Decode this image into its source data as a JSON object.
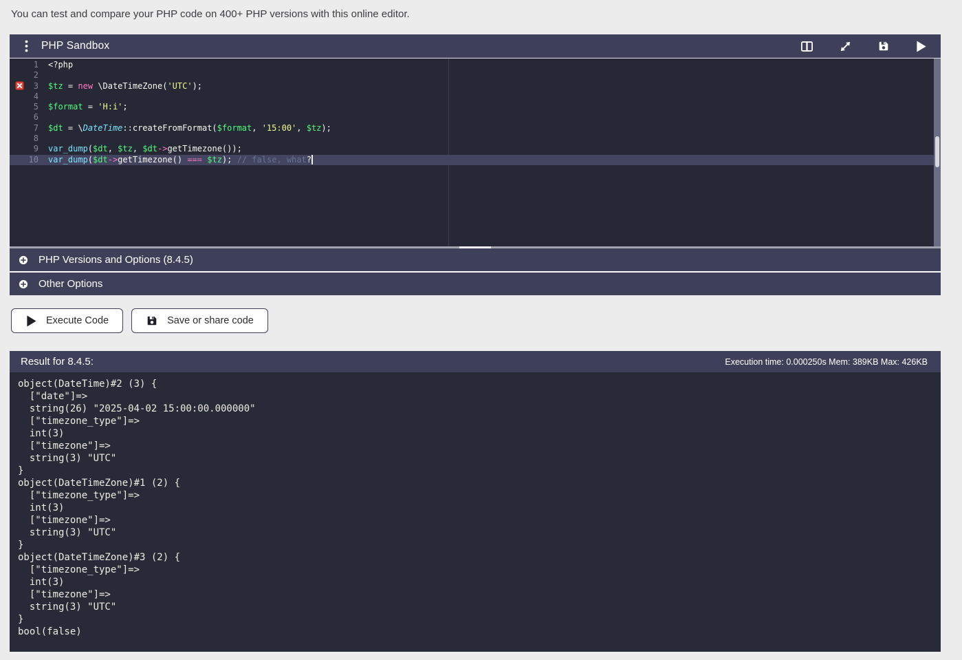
{
  "page": {
    "intro": "You can test and compare your PHP code on 400+ PHP versions with this online editor."
  },
  "colors": {
    "panel_bar": "#3e4059",
    "editor_bg": "#262836",
    "result_bg": "#282a38",
    "active_line": "#434560",
    "error_marker": "#d8453e",
    "token_variable": "#50fa7b",
    "token_keyword": "#ff79c6",
    "token_string": "#f1fa8c",
    "token_builtin": "#7be3fd",
    "token_comment": "#6a7193",
    "page_bg": "#ececec"
  },
  "editor": {
    "title": "PHP Sandbox",
    "menu_icon": "kebab-menu",
    "header_icons": [
      {
        "name": "split-view"
      },
      {
        "name": "fullscreen"
      },
      {
        "name": "save"
      },
      {
        "name": "run"
      }
    ],
    "active_line": 10,
    "error_line": 3,
    "lines": [
      {
        "n": "1",
        "tokens": [
          {
            "t": "<?php",
            "c": "p"
          }
        ]
      },
      {
        "n": "2",
        "tokens": []
      },
      {
        "n": "3",
        "error": true,
        "tokens": [
          {
            "t": "$tz",
            "c": "v"
          },
          {
            "t": " = ",
            "c": "p"
          },
          {
            "t": "new",
            "c": "k"
          },
          {
            "t": " \\DateTimeZone(",
            "c": "p"
          },
          {
            "t": "'UTC'",
            "c": "s"
          },
          {
            "t": ");",
            "c": "p"
          }
        ]
      },
      {
        "n": "4",
        "tokens": []
      },
      {
        "n": "5",
        "tokens": [
          {
            "t": "$format",
            "c": "v"
          },
          {
            "t": " = ",
            "c": "p"
          },
          {
            "t": "'H:i'",
            "c": "s"
          },
          {
            "t": ";",
            "c": "p"
          }
        ]
      },
      {
        "n": "6",
        "tokens": []
      },
      {
        "n": "7",
        "tokens": [
          {
            "t": "$dt",
            "c": "v"
          },
          {
            "t": " = \\",
            "c": "p"
          },
          {
            "t": "DateTime",
            "c": "ci"
          },
          {
            "t": "::createFromFormat(",
            "c": "p"
          },
          {
            "t": "$format",
            "c": "v"
          },
          {
            "t": ", ",
            "c": "p"
          },
          {
            "t": "'15:00'",
            "c": "s"
          },
          {
            "t": ", ",
            "c": "p"
          },
          {
            "t": "$tz",
            "c": "v"
          },
          {
            "t": ");",
            "c": "p"
          }
        ]
      },
      {
        "n": "8",
        "tokens": []
      },
      {
        "n": "9",
        "tokens": [
          {
            "t": "var_dump",
            "c": "f"
          },
          {
            "t": "(",
            "c": "p"
          },
          {
            "t": "$dt",
            "c": "v"
          },
          {
            "t": ", ",
            "c": "p"
          },
          {
            "t": "$tz",
            "c": "v"
          },
          {
            "t": ", ",
            "c": "p"
          },
          {
            "t": "$dt",
            "c": "v"
          },
          {
            "t": "->",
            "c": "o"
          },
          {
            "t": "getTimezone());",
            "c": "p"
          }
        ]
      },
      {
        "n": "10",
        "active": true,
        "cursor": true,
        "tokens": [
          {
            "t": "var_dump",
            "c": "f"
          },
          {
            "t": "(",
            "c": "p"
          },
          {
            "t": "$dt",
            "c": "v"
          },
          {
            "t": "->",
            "c": "o"
          },
          {
            "t": "getTimezone() ",
            "c": "p"
          },
          {
            "t": "===",
            "c": "o"
          },
          {
            "t": " ",
            "c": "p"
          },
          {
            "t": "$tz",
            "c": "v"
          },
          {
            "t": "); ",
            "c": "p"
          },
          {
            "t": "// false, what",
            "c": "c"
          },
          {
            "t": "?",
            "c": "w"
          }
        ]
      }
    ]
  },
  "accordions": [
    {
      "label": "PHP Versions and Options (8.4.5)",
      "icon": "plus-circle"
    },
    {
      "label": "Other Options",
      "icon": "plus-circle"
    }
  ],
  "buttons": [
    {
      "label": "Execute Code",
      "icon": "run"
    },
    {
      "label": "Save or share code",
      "icon": "save"
    }
  ],
  "result": {
    "title": "Result for 8.4.5:",
    "stats": "Execution time: 0.000250s Mem: 389KB Max: 426KB",
    "output_lines": [
      "object(DateTime)#2 (3) {",
      "  [\"date\"]=>",
      "  string(26) \"2025-04-02 15:00:00.000000\"",
      "  [\"timezone_type\"]=>",
      "  int(3)",
      "  [\"timezone\"]=>",
      "  string(3) \"UTC\"",
      "}",
      "object(DateTimeZone)#1 (2) {",
      "  [\"timezone_type\"]=>",
      "  int(3)",
      "  [\"timezone\"]=>",
      "  string(3) \"UTC\"",
      "}",
      "object(DateTimeZone)#3 (2) {",
      "  [\"timezone_type\"]=>",
      "  int(3)",
      "  [\"timezone\"]=>",
      "  string(3) \"UTC\"",
      "}",
      "bool(false)"
    ]
  }
}
